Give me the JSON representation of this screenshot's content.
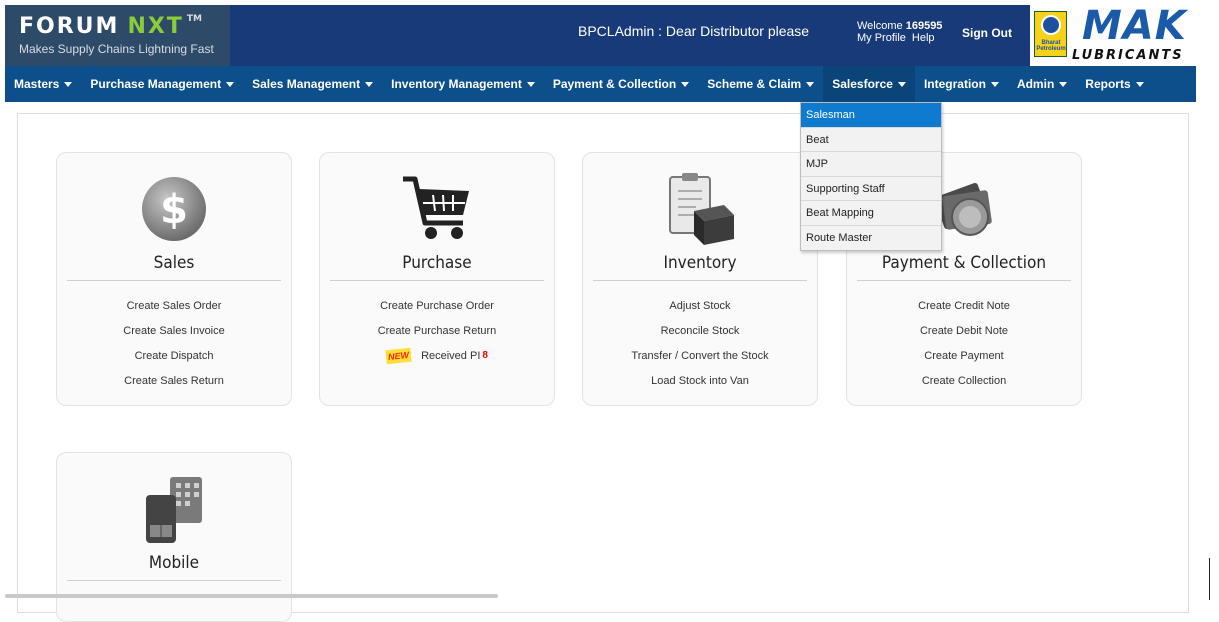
{
  "header": {
    "logo_main": "FORUM",
    "logo_accent": "NXT",
    "logo_tm": "TM",
    "tagline": "Makes Supply Chains Lightning Fast",
    "marquee": "BPCLAdmin : Dear Distributor please",
    "welcome_label": "Welcome",
    "user_id": "169595",
    "my_profile": "My Profile",
    "help": "Help",
    "sign_out": "Sign Out",
    "brand_name": "MAK",
    "brand_sub": "LUBRICANTS",
    "bp_text": "Bharat Petroleum"
  },
  "nav": {
    "items": [
      {
        "label": "Masters"
      },
      {
        "label": "Purchase Management"
      },
      {
        "label": "Sales Management"
      },
      {
        "label": "Inventory Management"
      },
      {
        "label": "Payment & Collection"
      },
      {
        "label": "Scheme & Claim"
      },
      {
        "label": "Salesforce"
      },
      {
        "label": "Integration"
      },
      {
        "label": "Admin"
      },
      {
        "label": "Reports"
      }
    ]
  },
  "salesforce_menu": {
    "items": [
      {
        "label": "Salesman"
      },
      {
        "label": "Beat"
      },
      {
        "label": "MJP"
      },
      {
        "label": "Supporting Staff"
      },
      {
        "label": "Beat Mapping"
      },
      {
        "label": "Route Master"
      }
    ]
  },
  "cards": {
    "sales": {
      "title": "Sales",
      "links": [
        "Create Sales Order",
        "Create Sales Invoice",
        "Create Dispatch",
        "Create Sales Return"
      ]
    },
    "purchase": {
      "title": "Purchase",
      "links": [
        "Create Purchase Order",
        "Create Purchase Return"
      ],
      "new_badge": "NEW",
      "received": "Received PI",
      "received_count": "8"
    },
    "inventory": {
      "title": "Inventory",
      "links": [
        "Adjust Stock",
        "Reconcile Stock",
        "Transfer / Convert the Stock",
        "Load Stock into Van"
      ]
    },
    "payment": {
      "title": "Payment & Collection",
      "links": [
        "Create Credit Note",
        "Create Debit Note",
        "Create Payment",
        "Create Collection"
      ]
    },
    "mobile": {
      "title": "Mobile"
    }
  }
}
